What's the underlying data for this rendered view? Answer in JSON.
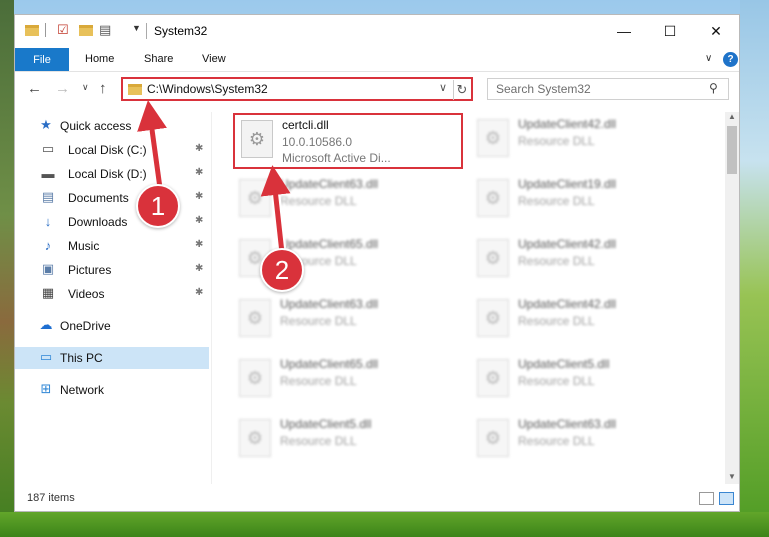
{
  "window": {
    "title": "System32",
    "minimize_glyph": "—",
    "maximize_glyph": "☐",
    "close_glyph": "✕"
  },
  "ribbon": {
    "tabs": [
      "File",
      "Home",
      "Share",
      "View"
    ],
    "help_glyph": "?"
  },
  "nav": {
    "address": "C:\\Windows\\System32",
    "search_placeholder": "Search System32"
  },
  "sidebar": {
    "items": [
      {
        "label": "Quick access",
        "icon": "star-icon"
      },
      {
        "label": "Local Disk (C:)",
        "icon": "drive-icon"
      },
      {
        "label": "Local Disk (D:)",
        "icon": "drive-icon"
      },
      {
        "label": "Documents",
        "icon": "documents-icon"
      },
      {
        "label": "Downloads",
        "icon": "download-icon"
      },
      {
        "label": "Music",
        "icon": "music-icon"
      },
      {
        "label": "Pictures",
        "icon": "pictures-icon"
      },
      {
        "label": "Videos",
        "icon": "video-icon"
      },
      {
        "label": "OneDrive",
        "icon": "cloud-icon"
      },
      {
        "label": "This PC",
        "icon": "pc-icon"
      },
      {
        "label": "Network",
        "icon": "network-icon"
      }
    ]
  },
  "files": {
    "selected": {
      "name": "certcli.dll",
      "version": "10.0.10586.0",
      "description": "Microsoft Active Di..."
    },
    "items": [
      {
        "name": "UpdateClient42.dll",
        "type": "Resource DLL"
      },
      {
        "name": "UpdateClient63.dll",
        "type": "Resource DLL"
      },
      {
        "name": "UpdateClient19.dll",
        "type": "Resource DLL"
      },
      {
        "name": "UpdateClient65.dll",
        "type": "Resource DLL"
      },
      {
        "name": "UpdateClient42.dll",
        "type": "Resource DLL"
      },
      {
        "name": "UpdateClient63.dll",
        "type": "Resource DLL"
      },
      {
        "name": "UpdateClient42.dll",
        "type": "Resource DLL"
      },
      {
        "name": "UpdateClient65.dll",
        "type": "Resource DLL"
      },
      {
        "name": "UpdateClient5.dll",
        "type": "Resource DLL"
      },
      {
        "name": "UpdateClient5.dll",
        "type": "Resource DLL"
      },
      {
        "name": "UpdateClient63.dll",
        "type": "Resource DLL"
      }
    ]
  },
  "status": {
    "item_count": "187 items"
  },
  "annotations": {
    "callout_1": "1",
    "callout_2": "2",
    "accent_color": "#d9323b"
  }
}
